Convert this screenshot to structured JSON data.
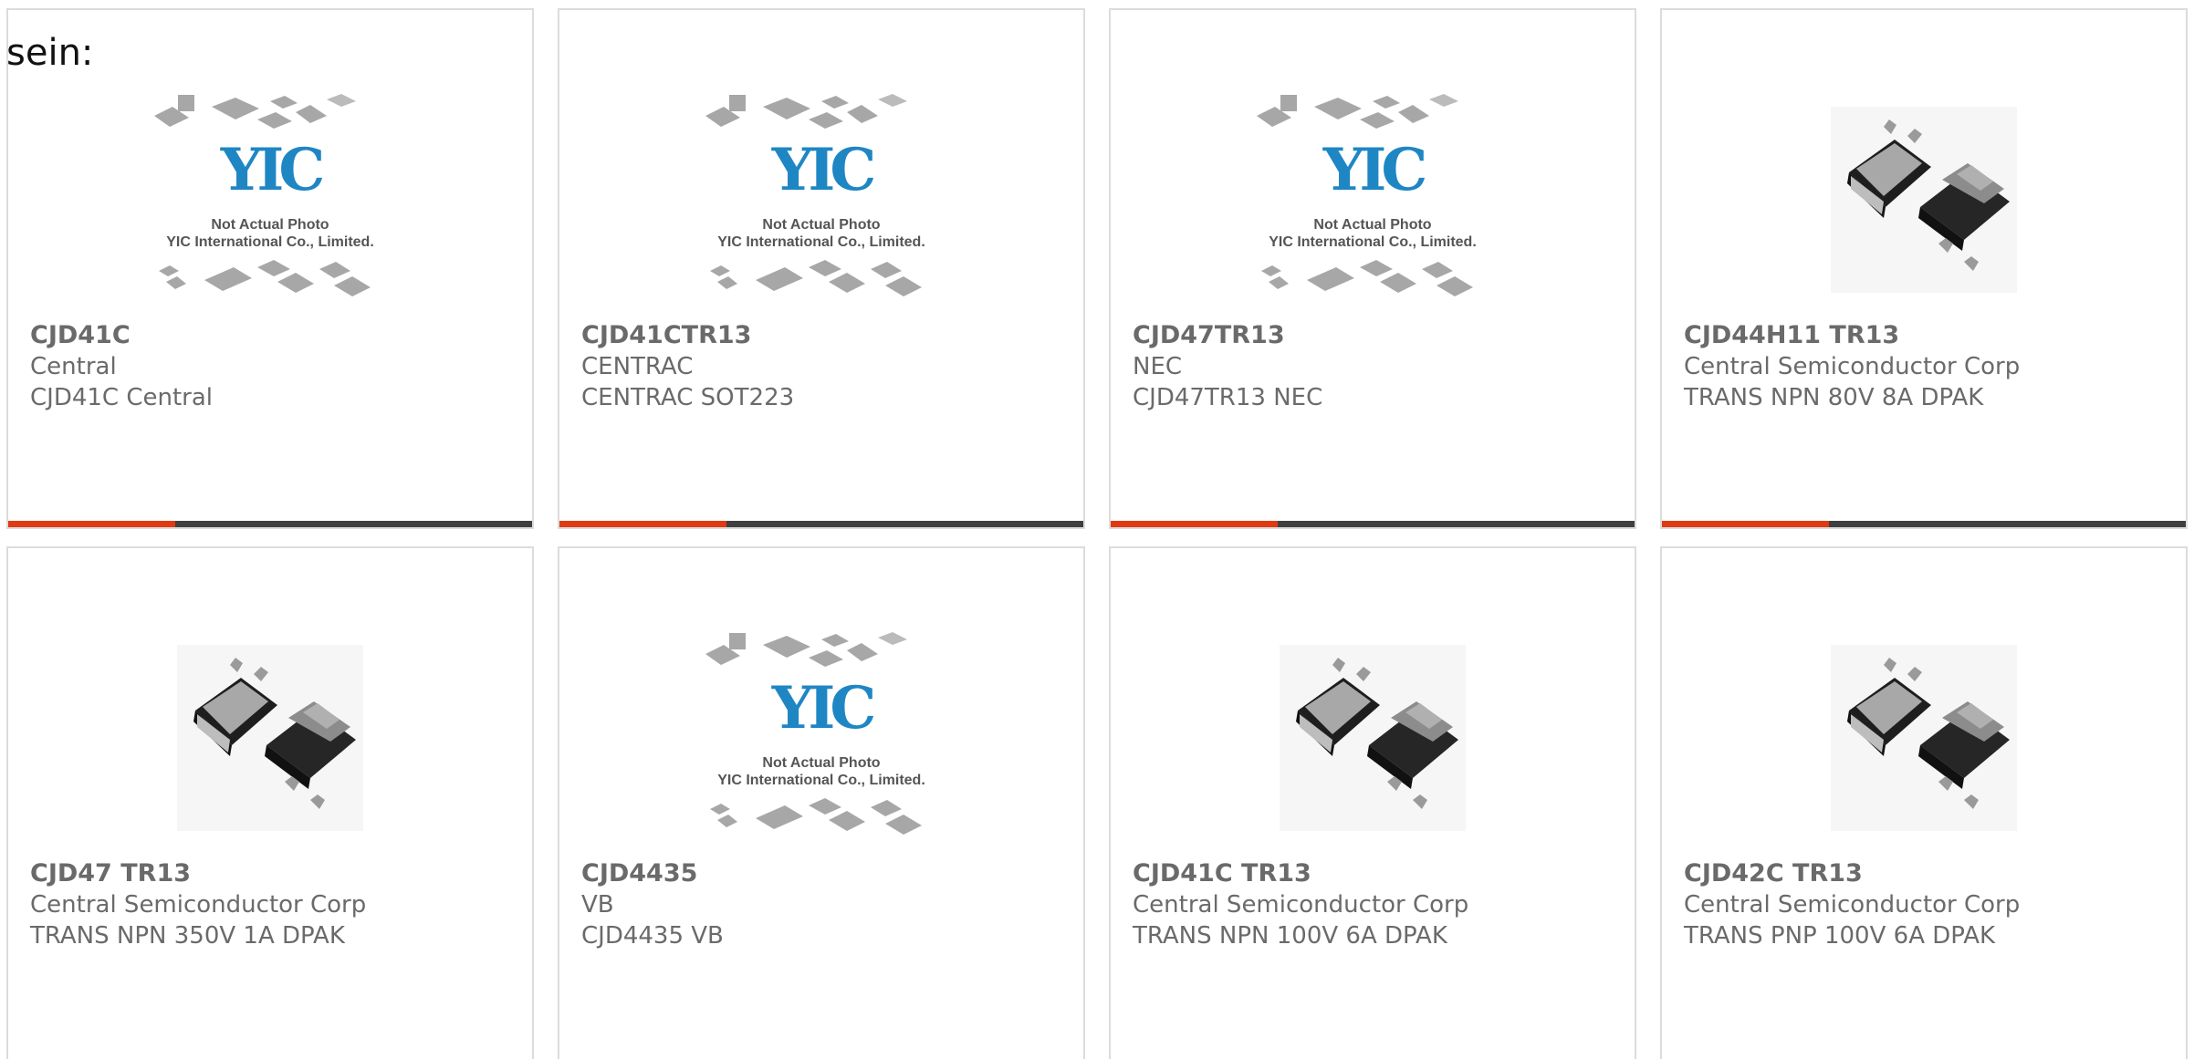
{
  "intro_text": "sein:",
  "placeholder": {
    "logo_text": "YIC",
    "line1": "Not Actual Photo",
    "line2": "YIC International Co., Limited."
  },
  "colors": {
    "accent": "#e03a12",
    "bar": "#3f3f3f",
    "text": "#6a6a6a",
    "border": "#dcdcdc",
    "logo": "#1f86c4"
  },
  "products": [
    {
      "part": "CJD41C",
      "manufacturer": "Central",
      "description": "CJD41C Central",
      "image": "yic-placeholder-image"
    },
    {
      "part": "CJD41CTR13",
      "manufacturer": "CENTRAC",
      "description": "CENTRAC SOT223",
      "image": "yic-placeholder-image"
    },
    {
      "part": "CJD47TR13",
      "manufacturer": "NEC",
      "description": "CJD47TR13 NEC",
      "image": "yic-placeholder-image"
    },
    {
      "part": "CJD44H11 TR13",
      "manufacturer": "Central Semiconductor Corp",
      "description": "TRANS NPN 80V 8A DPAK",
      "image": "dpak-package-image"
    },
    {
      "part": "CJD47 TR13",
      "manufacturer": "Central Semiconductor Corp",
      "description": "TRANS NPN 350V 1A DPAK",
      "image": "dpak-package-image"
    },
    {
      "part": "CJD4435",
      "manufacturer": "VB",
      "description": "CJD4435 VB",
      "image": "yic-placeholder-image"
    },
    {
      "part": "CJD41C TR13",
      "manufacturer": "Central Semiconductor Corp",
      "description": "TRANS NPN 100V 6A DPAK",
      "image": "dpak-package-image"
    },
    {
      "part": "CJD42C TR13",
      "manufacturer": "Central Semiconductor Corp",
      "description": "TRANS PNP 100V 6A DPAK",
      "image": "dpak-package-image"
    }
  ]
}
